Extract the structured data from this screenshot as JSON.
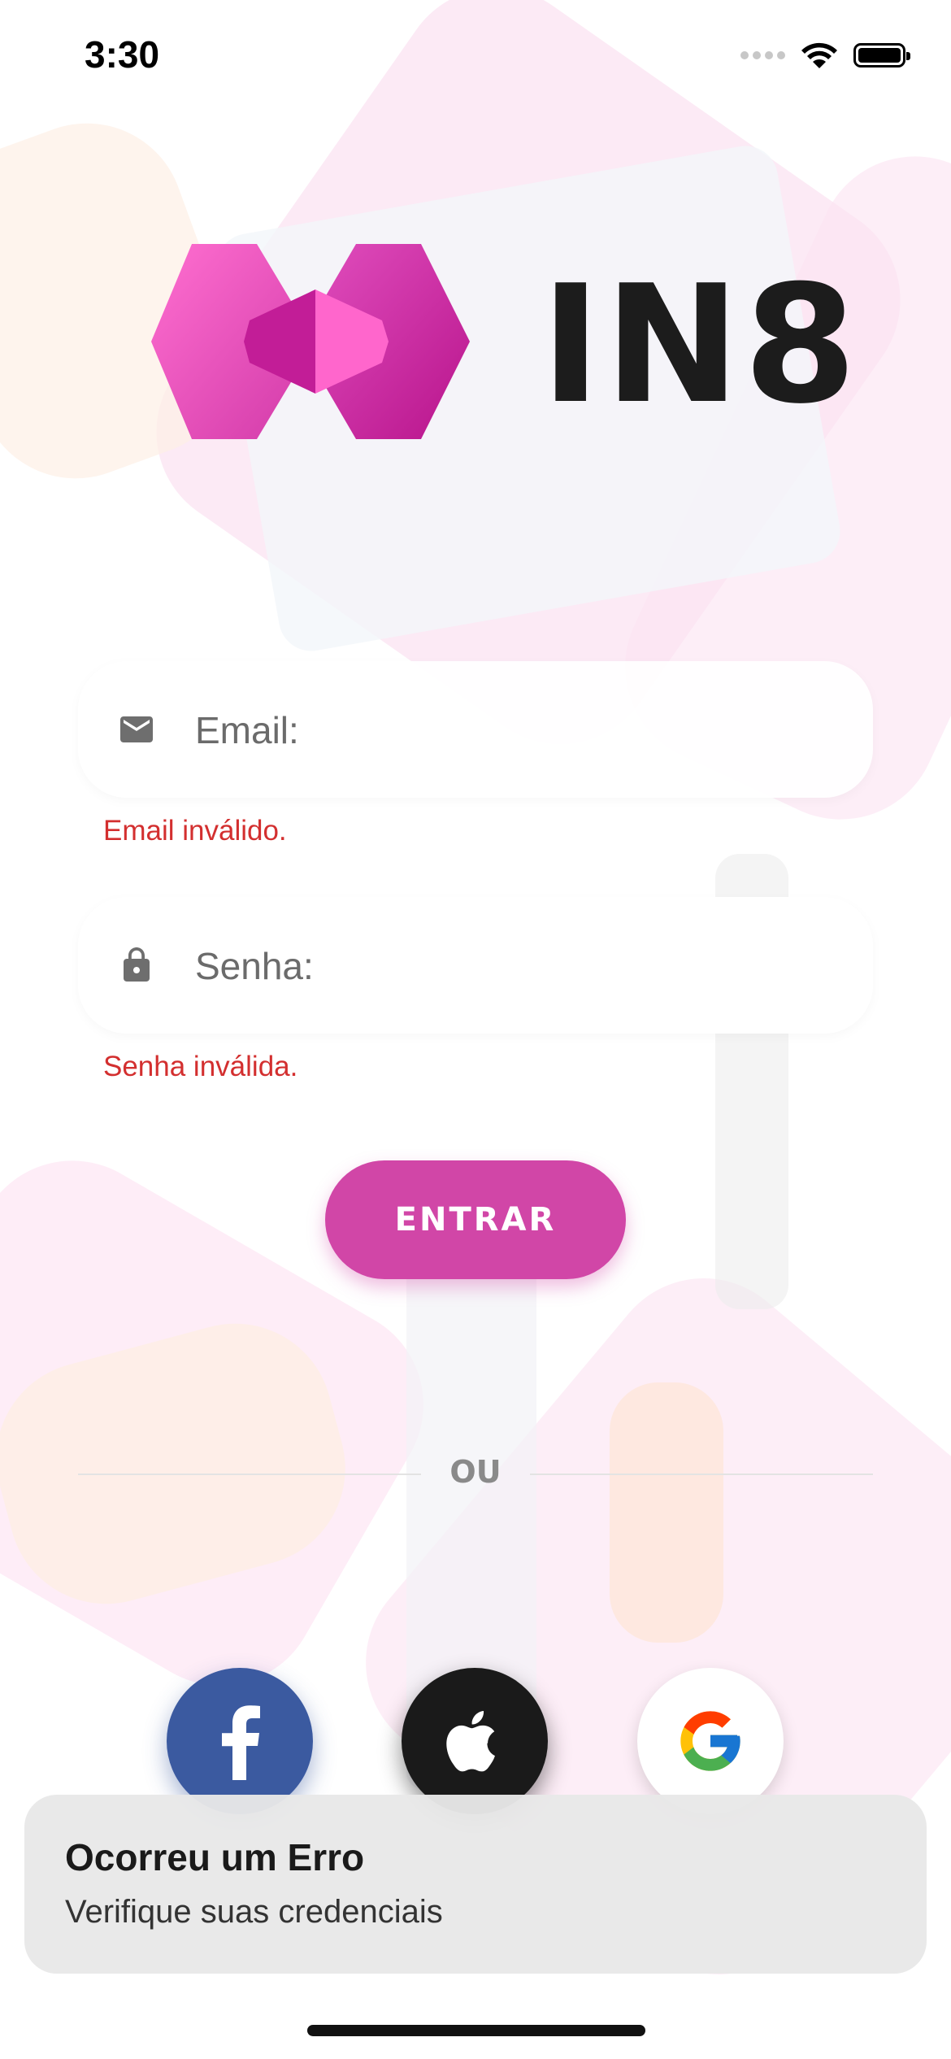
{
  "status_bar": {
    "time": "3:30"
  },
  "brand": {
    "name": "IN8",
    "primary_color": "#d146a7"
  },
  "login_form": {
    "email": {
      "placeholder": "Email:",
      "error": "Email inválido.",
      "icon": "mail-icon"
    },
    "password": {
      "placeholder": "Senha:",
      "error": "Senha inválida.",
      "icon": "lock-icon"
    },
    "submit_label": "ENTRAR"
  },
  "separator": {
    "label": "OU"
  },
  "social_login": [
    {
      "provider": "facebook",
      "icon": "facebook-icon",
      "color": "#3b5aa0"
    },
    {
      "provider": "apple",
      "icon": "apple-icon",
      "color": "#1a1a1a"
    },
    {
      "provider": "google",
      "icon": "google-icon",
      "color": "#ffffff"
    }
  ],
  "toast": {
    "title": "Ocorreu um Erro",
    "message": "Verifique suas credenciais"
  },
  "error_color": "#d32f2f"
}
